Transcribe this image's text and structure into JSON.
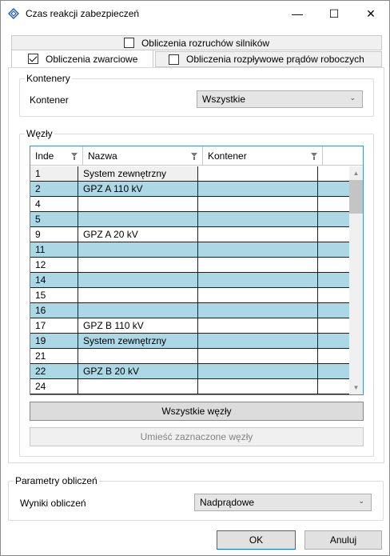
{
  "window": {
    "title": "Czas reakcji zabezpieczeń",
    "minimize_glyph": "—",
    "maximize_glyph": "☐",
    "close_glyph": "✕"
  },
  "tabs": {
    "silniki": {
      "label": "Obliczenia rozruchów silników",
      "checked": false
    },
    "zwarcia": {
      "label": "Obliczenia zwarciowe",
      "checked": true
    },
    "rozplyw": {
      "label": "Obliczenia rozpływowe prądów roboczych",
      "checked": false
    }
  },
  "kontenery": {
    "title": "Kontenery",
    "label": "Kontener",
    "value": "Wszystkie"
  },
  "wezly": {
    "title": "Węzły",
    "columns": [
      "Inde",
      "Nazwa",
      "Kontener"
    ],
    "rows": [
      {
        "idx": "1",
        "name": "System zewnętrzny",
        "kont": ""
      },
      {
        "idx": "2",
        "name": "GPZ A 110 kV",
        "kont": ""
      },
      {
        "idx": "4",
        "name": "",
        "kont": ""
      },
      {
        "idx": "5",
        "name": "",
        "kont": ""
      },
      {
        "idx": "9",
        "name": "GPZ A 20 kV",
        "kont": ""
      },
      {
        "idx": "11",
        "name": "",
        "kont": ""
      },
      {
        "idx": "12",
        "name": "",
        "kont": ""
      },
      {
        "idx": "14",
        "name": "",
        "kont": ""
      },
      {
        "idx": "15",
        "name": "",
        "kont": ""
      },
      {
        "idx": "16",
        "name": "",
        "kont": ""
      },
      {
        "idx": "17",
        "name": "GPZ B 110 kV",
        "kont": ""
      },
      {
        "idx": "19",
        "name": "System zewnętrzny",
        "kont": ""
      },
      {
        "idx": "21",
        "name": "",
        "kont": ""
      },
      {
        "idx": "22",
        "name": "GPZ B 20 kV",
        "kont": ""
      },
      {
        "idx": "24",
        "name": "",
        "kont": ""
      }
    ],
    "btn_all": "Wszystkie węzły",
    "btn_place": "Umieść zaznaczone węzły"
  },
  "params": {
    "title": "Parametry obliczeń",
    "label": "Wyniki obliczeń",
    "value": "Nadprądowe"
  },
  "footer": {
    "ok": "OK",
    "cancel": "Anuluj"
  },
  "colors": {
    "row_highlight": "#acd8e6",
    "grid_border": "#4a90c8",
    "ok_border": "#0078d7"
  }
}
